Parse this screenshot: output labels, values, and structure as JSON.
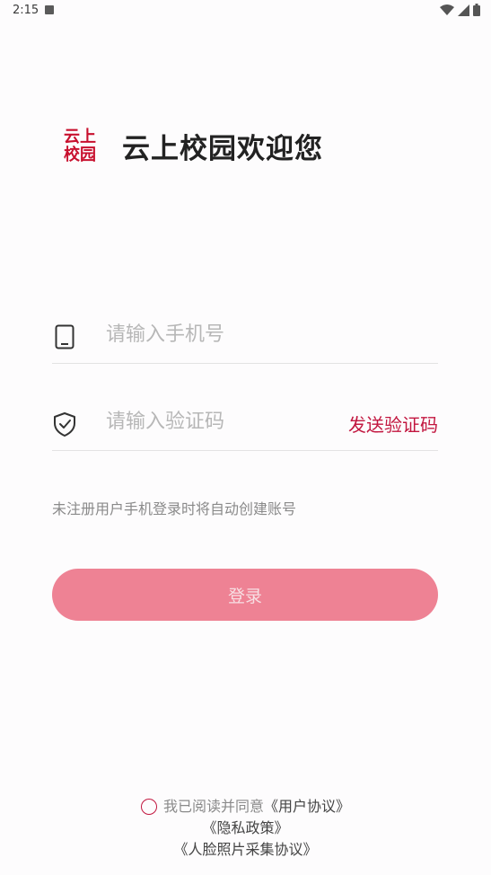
{
  "status_bar": {
    "time": "2:15"
  },
  "brand": {
    "logo_line1": "云上",
    "logo_line2": "校园",
    "title": "云上校园欢迎您"
  },
  "phone_field": {
    "placeholder": "请输入手机号",
    "value": "",
    "icon": "phone-icon"
  },
  "code_field": {
    "placeholder": "请输入验证码",
    "value": "",
    "icon": "shield-check-icon",
    "send_label": "发送验证码"
  },
  "hint": "未注册用户手机登录时将自动创建账号",
  "login": {
    "label": "登录"
  },
  "agreement": {
    "prefix": "我已阅读并同意",
    "user_agreement": "《用户协议》",
    "privacy_policy": "《隐私政策》",
    "face_agreement": "《人脸照片采集协议》"
  },
  "colors": {
    "accent": "#c2163f",
    "button": "#ee8294",
    "logo": "#c8102e"
  }
}
